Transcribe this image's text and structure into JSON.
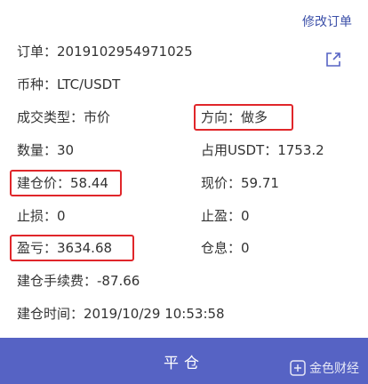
{
  "header": {
    "modify_order": "修改订单",
    "share_icon": "share-icon"
  },
  "order": {
    "order_no": "订单：2019102954971025",
    "currency": "币种：LTC/USDT",
    "trade_type": "成交类型：市价",
    "direction": "方向：做多",
    "quantity": "数量：30",
    "usdt_used": "占用USDT：1753.2",
    "open_price": "建仓价：58.44",
    "current_price": "现价：59.71",
    "stop_loss": "止损：0",
    "take_profit": "止盈：0",
    "profit_loss": "盈亏：3634.68",
    "interest": "仓息：0",
    "open_fee": "建仓手续费：-87.66",
    "open_time": "建仓时间：2019/10/29 10:53:58"
  },
  "footer": {
    "close_button": "平仓",
    "watermark": "金色财经"
  },
  "colors": {
    "primary": "#5663c4",
    "highlight_border": "#e0262a",
    "link": "#3b4fa8"
  }
}
